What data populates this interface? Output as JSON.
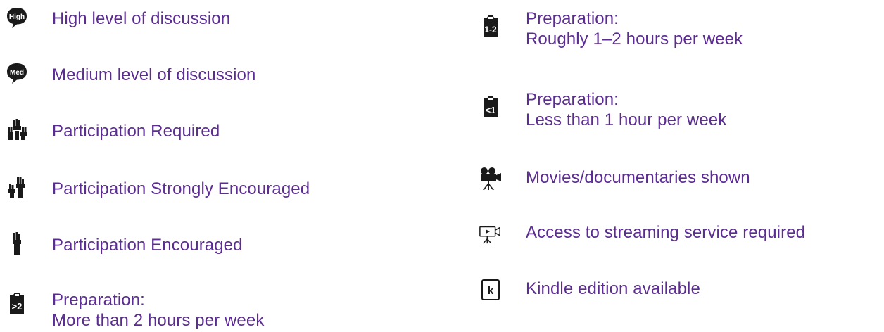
{
  "legend": {
    "left": [
      {
        "icon": "high-discussion-bubble-icon",
        "badge": "High",
        "label": "High level of discussion"
      },
      {
        "icon": "medium-discussion-bubble-icon",
        "badge": "Med",
        "label": "Medium level of discussion"
      },
      {
        "icon": "participation-required-hands-icon",
        "label": "Participation Required"
      },
      {
        "icon": "participation-strongly-encouraged-hands-icon",
        "label": "Participation Strongly Encouraged"
      },
      {
        "icon": "participation-encouraged-hand-icon",
        "label": "Participation Encouraged"
      },
      {
        "icon": "clipboard-more-than-2-icon",
        "badge": ">2",
        "label_line1": "Preparation:",
        "label_line2": "More than 2 hours per week"
      }
    ],
    "right": [
      {
        "icon": "clipboard-1-2-icon",
        "badge": "1-2",
        "label_line1": "Preparation:",
        "label_line2": "Roughly 1–2 hours per week"
      },
      {
        "icon": "clipboard-less-than-1-icon",
        "badge": "<1",
        "label_line1": "Preparation:",
        "label_line2": "Less than 1 hour per week"
      },
      {
        "icon": "movie-camera-icon",
        "label": "Movies/documentaries shown"
      },
      {
        "icon": "streaming-camera-icon",
        "label": "Access to streaming service required"
      },
      {
        "icon": "kindle-icon",
        "badge": "k",
        "label": "Kindle edition available"
      }
    ],
    "colors": {
      "text": "#5b2c91",
      "icon": "#1a1a1a"
    }
  }
}
